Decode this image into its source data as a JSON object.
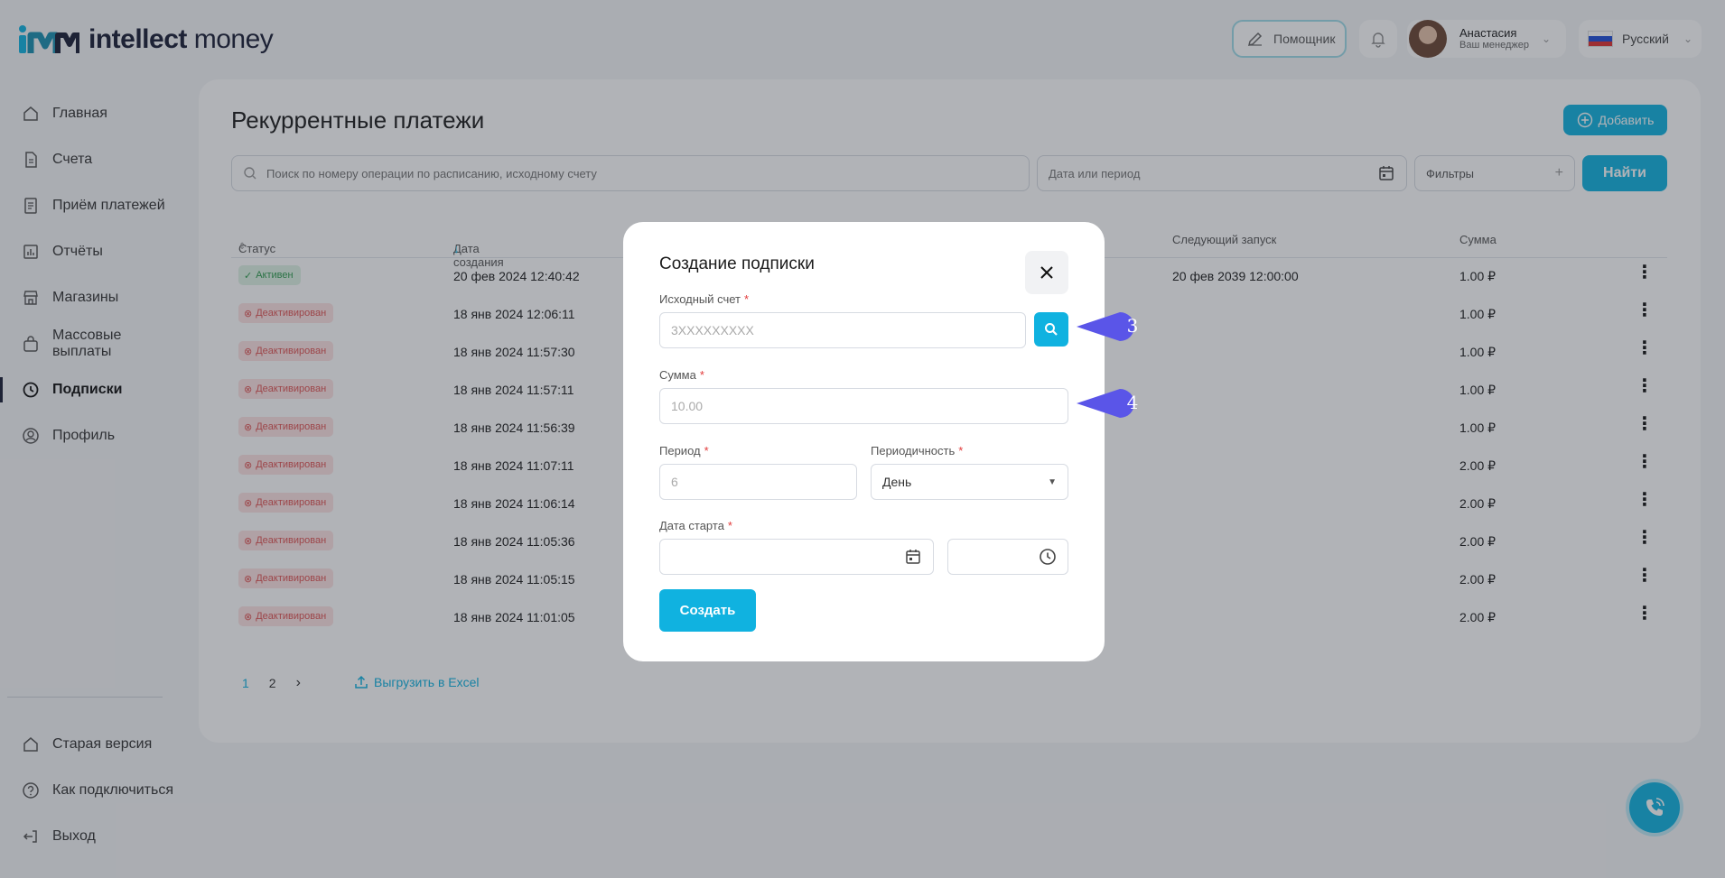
{
  "brand": {
    "logo_bold": "intellect",
    "logo_light": "money"
  },
  "header": {
    "helper_label": "Помощник",
    "user_name": "Анастасия",
    "user_role": "Ваш менеджер",
    "language": "Русский"
  },
  "sidebar": {
    "items": [
      {
        "label": "Главная",
        "icon": "home-icon"
      },
      {
        "label": "Счета",
        "icon": "document-icon"
      },
      {
        "label": "Приём платежей",
        "icon": "receipt-icon"
      },
      {
        "label": "Отчёты",
        "icon": "chart-icon"
      },
      {
        "label": "Магазины",
        "icon": "store-icon"
      },
      {
        "label": "Массовые выплаты",
        "icon": "bag-icon"
      },
      {
        "label": "Подписки",
        "icon": "clock-icon",
        "active": true
      },
      {
        "label": "Профиль",
        "icon": "user-icon"
      }
    ],
    "bottom_items": [
      {
        "label": "Старая версия",
        "icon": "home-icon"
      },
      {
        "label": "Как подключиться",
        "icon": "help-icon"
      },
      {
        "label": "Выход",
        "icon": "logout-icon"
      }
    ]
  },
  "page": {
    "title": "Рекуррентные платежи",
    "add_label": "Добавить",
    "search_placeholder": "Поиск по номеру операции по расписанию, исходному счету",
    "date_placeholder": "Дата или период",
    "filters_label": "Фильтры",
    "find_label": "Найти"
  },
  "table": {
    "columns": [
      "Статус",
      "Дата создания",
      "Следующий запуск",
      "Сумма"
    ],
    "rows": [
      {
        "status": "Активен",
        "active": true,
        "created": "20 фев 2024 12:40:42",
        "next": "20 фев 2039 12:00:00",
        "amount": "1.00 ₽"
      },
      {
        "status": "Деактивирован",
        "active": false,
        "created": "18 янв 2024 12:06:11",
        "next": "",
        "amount": "1.00 ₽"
      },
      {
        "status": "Деактивирован",
        "active": false,
        "created": "18 янв 2024 11:57:30",
        "next": "",
        "amount": "1.00 ₽"
      },
      {
        "status": "Деактивирован",
        "active": false,
        "created": "18 янв 2024 11:57:11",
        "next": "",
        "amount": "1.00 ₽"
      },
      {
        "status": "Деактивирован",
        "active": false,
        "created": "18 янв 2024 11:56:39",
        "next": "",
        "amount": "1.00 ₽"
      },
      {
        "status": "Деактивирован",
        "active": false,
        "created": "18 янв 2024 11:07:11",
        "next": "",
        "amount": "2.00 ₽"
      },
      {
        "status": "Деактивирован",
        "active": false,
        "created": "18 янв 2024 11:06:14",
        "next": "",
        "amount": "2.00 ₽"
      },
      {
        "status": "Деактивирован",
        "active": false,
        "created": "18 янв 2024 11:05:36",
        "next": "",
        "amount": "2.00 ₽"
      },
      {
        "status": "Деактивирован",
        "active": false,
        "created": "18 янв 2024 11:05:15",
        "next": "",
        "amount": "2.00 ₽"
      },
      {
        "status": "Деактивирован",
        "active": false,
        "created": "18 янв 2024 11:01:05",
        "next": "",
        "amount": "2.00 ₽"
      }
    ]
  },
  "pagination": {
    "pages": [
      "1",
      "2"
    ],
    "current": "1",
    "export_label": "Выгрузить в Excel"
  },
  "modal": {
    "title": "Создание подписки",
    "source_account_label": "Исходный счет",
    "source_account_placeholder": "3XXXXXXXXX",
    "amount_label": "Сумма",
    "amount_placeholder": "10.00",
    "period_label": "Период",
    "period_placeholder": "6",
    "frequency_label": "Периодичность",
    "frequency_value": "День",
    "start_date_label": "Дата старта",
    "required_mark": "*",
    "create_label": "Создать"
  },
  "callouts": [
    "3",
    "4"
  ],
  "colors": {
    "accent": "#10b2e0",
    "callout": "#5a55e8",
    "active_badge": "#2e9b4f",
    "inactive_badge": "#e05454"
  }
}
